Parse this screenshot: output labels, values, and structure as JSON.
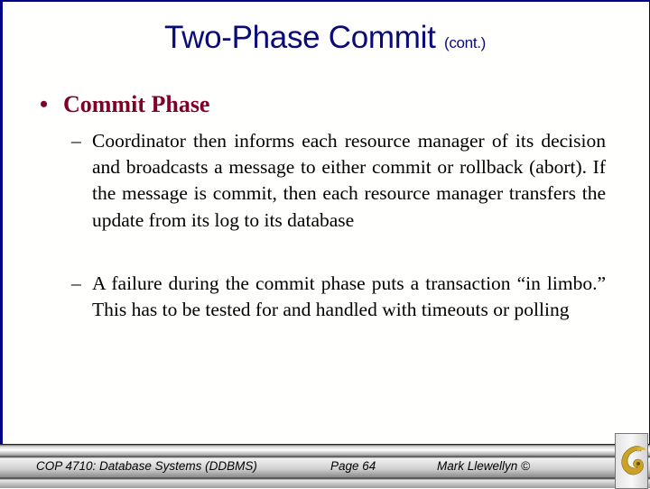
{
  "slide": {
    "title": "Two-Phase Commit",
    "title_suffix": "(cont.)",
    "bullet": {
      "marker": "•",
      "label": "Commit Phase"
    },
    "sub_bullets": [
      {
        "marker": "–",
        "text": "Coordinator then informs each resource manager of its decision and broadcasts a message to either commit or rollback (abort).  If the message is commit, then each resource manager transfers the update from its log to its database"
      },
      {
        "marker": "–",
        "text": "A failure during the commit phase puts a transaction “in limbo.” This has to be tested for and handled with timeouts or polling"
      }
    ]
  },
  "footer": {
    "course": "COP 4710: Database Systems  (DDBMS)",
    "page": "Page 64",
    "author": "Mark Llewellyn ©",
    "logo_icon": "ucf-pegasus-logo-icon"
  },
  "colors": {
    "border": "#00008b",
    "title": "#0a0a78",
    "bullet": "#800028",
    "logo_gold": "#c9a227"
  }
}
